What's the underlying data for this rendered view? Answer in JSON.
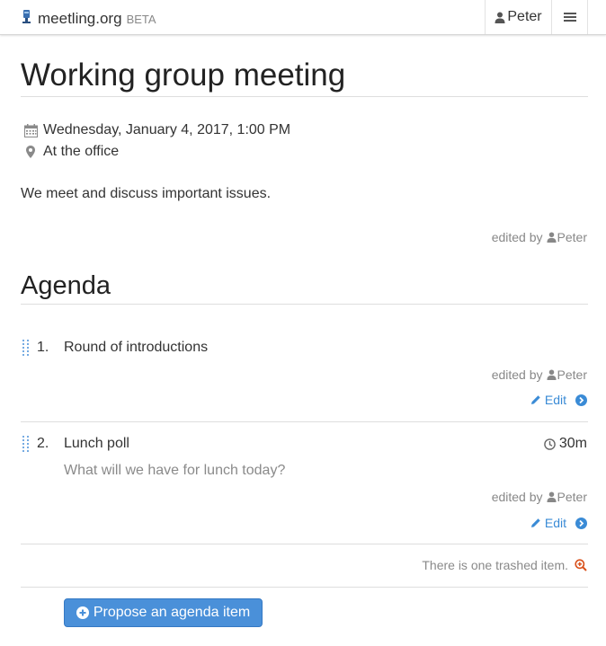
{
  "navbar": {
    "brand": "meetling.org",
    "beta": "BETA",
    "user": "Peter",
    "menu_icon": "hamburger-icon"
  },
  "meeting": {
    "title": "Working group meeting",
    "date": "Wednesday, January 4, 2017, 1:00 PM",
    "location": "At the office",
    "description": "We meet and discuss important issues.",
    "edited_by_label": "edited by",
    "edited_by_user": "Peter"
  },
  "agenda": {
    "heading": "Agenda",
    "items": [
      {
        "number": "1.",
        "title": "Round of introductions",
        "description": "",
        "duration": "",
        "edited_by_label": "edited by",
        "edited_by_user": "Peter",
        "edit_label": "Edit"
      },
      {
        "number": "2.",
        "title": "Lunch poll",
        "description": "What will we have for lunch today?",
        "duration": "30m",
        "edited_by_label": "edited by",
        "edited_by_user": "Peter",
        "edit_label": "Edit"
      }
    ],
    "trashed_text": "There is one trashed item.",
    "propose_label": "Propose an agenda item"
  },
  "colors": {
    "accent": "#4a90d9",
    "link": "#3a8bd6",
    "trash_icon": "#d9501a"
  }
}
